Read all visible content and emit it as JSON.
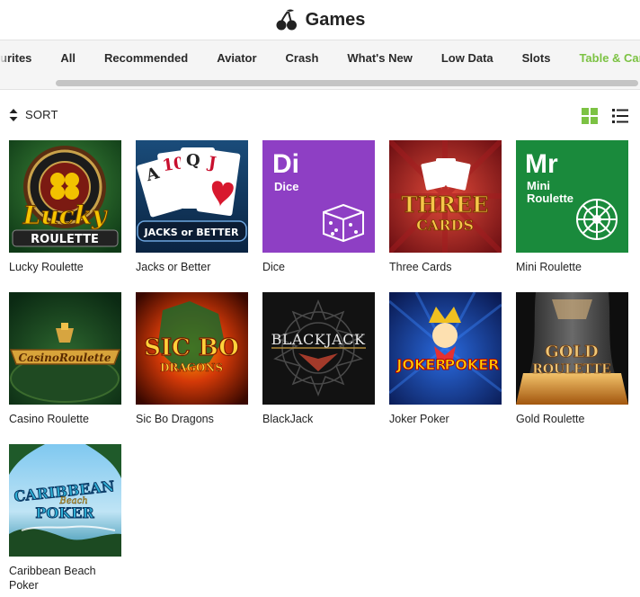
{
  "header": {
    "title": "Games",
    "logo_icon": "cherries-icon"
  },
  "tabs": [
    {
      "label": "urites",
      "active": false
    },
    {
      "label": "All",
      "active": false
    },
    {
      "label": "Recommended",
      "active": false
    },
    {
      "label": "Aviator",
      "active": false
    },
    {
      "label": "Crash",
      "active": false
    },
    {
      "label": "What's New",
      "active": false
    },
    {
      "label": "Low Data",
      "active": false
    },
    {
      "label": "Slots",
      "active": false
    },
    {
      "label": "Table & Card",
      "active": true
    }
  ],
  "toolbar": {
    "sort_label": "SORT",
    "sort_icon": "sort-arrows-icon",
    "grid_view_icon": "grid-view-icon",
    "list_view_icon": "list-view-icon"
  },
  "colors": {
    "accent": "#7cc243"
  },
  "games": [
    {
      "label": "Lucky Roulette",
      "art": {
        "line1": "Lucky",
        "line2": "ROULETTE"
      }
    },
    {
      "label": "Jacks or Better",
      "art": {
        "line1": "JACKS or BETTER",
        "cards": [
          "A",
          "10",
          "Q",
          "J"
        ]
      }
    },
    {
      "label": "Dice",
      "art": {
        "symbol": "Di",
        "name": "Dice"
      }
    },
    {
      "label": "Three Cards",
      "art": {
        "line1": "THREE",
        "line2": "CARDS"
      }
    },
    {
      "label": "Mini Roulette",
      "art": {
        "symbol": "Mr",
        "name1": "Mini",
        "name2": "Roulette"
      }
    },
    {
      "label": "Casino Roulette",
      "art": {
        "line1": "CasinoRoulette"
      }
    },
    {
      "label": "Sic Bo Dragons",
      "art": {
        "line1": "SIC BO",
        "line2": "DRAGONS"
      }
    },
    {
      "label": "BlackJack",
      "art": {
        "line1": "BLACKJACK"
      }
    },
    {
      "label": "Joker Poker",
      "art": {
        "line1": "JOKER",
        "line2": "POKER"
      }
    },
    {
      "label": "Gold Roulette",
      "art": {
        "line1": "GOLD",
        "line2": "ROULETTE"
      }
    },
    {
      "label": "Caribbean Beach Poker",
      "art": {
        "line1": "CARIBBEAN",
        "line2": "Beach",
        "line3": "POKER"
      }
    }
  ]
}
